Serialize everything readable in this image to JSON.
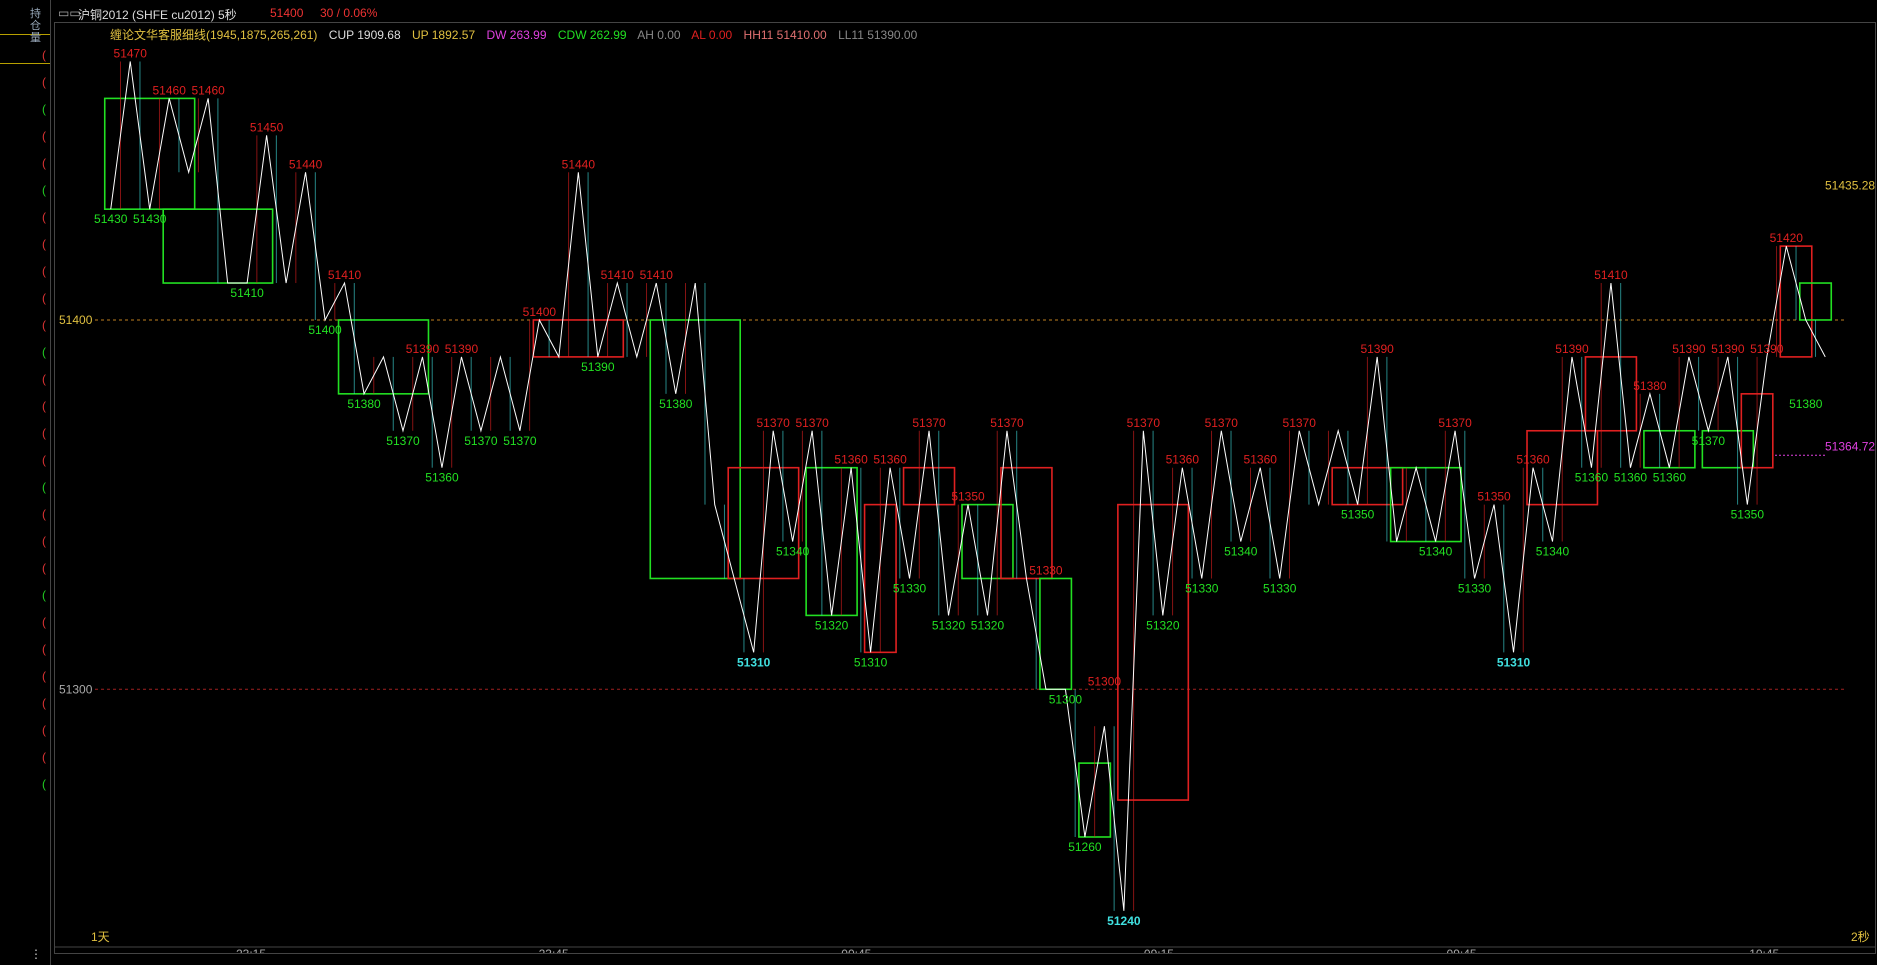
{
  "header": {
    "symbol": "沪铜2012 (SHFE cu2012)",
    "period": "5秒",
    "last_price": "51400",
    "change": "30 / 0.06%"
  },
  "indicator": {
    "name": "缠论文华客服细线(1945,1875,265,261)",
    "cup": "CUP 1909.68",
    "up": "UP 1892.57",
    "dw": "DW 263.99",
    "cdw": "CDW 262.99",
    "ah": "AH 0.00",
    "al": "AL 0.00",
    "hh": "HH11 51410.00",
    "ll": "LL11 51390.00"
  },
  "left_strip": {
    "vertical_text": "持仓量",
    "bottom": "⋮"
  },
  "colors": {
    "red": "#e02020",
    "green": "#22e022",
    "white": "#ffffff",
    "cyan": "#40e0e0",
    "gold": "#e0c040",
    "magenta": "#e040e0",
    "gray": "#aaaaaa"
  },
  "chart_data": {
    "type": "line",
    "y_range": [
      51234,
      51475
    ],
    "y_ticks": [
      {
        "value": 51400,
        "label": "51400"
      },
      {
        "value": 51300,
        "label": "51300"
      }
    ],
    "x_ticks": [
      "23:15",
      "23:45",
      "00:45",
      "09:15",
      "09:45",
      "10:45"
    ],
    "corner_labels": {
      "left": "1天",
      "right": "2秒"
    },
    "right_labels": [
      {
        "value": 51435.28,
        "label": "51435.28",
        "color": "gold"
      },
      {
        "value": 51364.72,
        "label": "51364.72",
        "color": "magenta"
      }
    ],
    "zigzag": [
      [
        0,
        51430
      ],
      [
        1,
        51470
      ],
      [
        2,
        51430
      ],
      [
        3,
        51460
      ],
      [
        4,
        51440
      ],
      [
        5,
        51460
      ],
      [
        6,
        51410
      ],
      [
        7,
        51410
      ],
      [
        8,
        51450
      ],
      [
        9,
        51410
      ],
      [
        10,
        51440
      ],
      [
        11,
        51400
      ],
      [
        12,
        51410
      ],
      [
        13,
        51380
      ],
      [
        14,
        51390
      ],
      [
        15,
        51370
      ],
      [
        16,
        51390
      ],
      [
        17,
        51360
      ],
      [
        18,
        51390
      ],
      [
        19,
        51370
      ],
      [
        20,
        51390
      ],
      [
        21,
        51370
      ],
      [
        22,
        51400
      ],
      [
        23,
        51390
      ],
      [
        24,
        51440
      ],
      [
        25,
        51390
      ],
      [
        26,
        51410
      ],
      [
        27,
        51390
      ],
      [
        28,
        51410
      ],
      [
        29,
        51380
      ],
      [
        30,
        51410
      ],
      [
        31,
        51350
      ],
      [
        32,
        51330
      ],
      [
        33,
        51310
      ],
      [
        34,
        51370
      ],
      [
        35,
        51340
      ],
      [
        36,
        51370
      ],
      [
        37,
        51320
      ],
      [
        38,
        51360
      ],
      [
        39,
        51310
      ],
      [
        40,
        51360
      ],
      [
        41,
        51330
      ],
      [
        42,
        51370
      ],
      [
        43,
        51320
      ],
      [
        44,
        51350
      ],
      [
        45,
        51320
      ],
      [
        46,
        51370
      ],
      [
        47,
        51330
      ],
      [
        48,
        51300
      ],
      [
        49,
        51300
      ],
      [
        50,
        51260
      ],
      [
        51,
        51290
      ],
      [
        52,
        51240
      ],
      [
        53,
        51370
      ],
      [
        54,
        51320
      ],
      [
        55,
        51360
      ],
      [
        56,
        51330
      ],
      [
        57,
        51370
      ],
      [
        58,
        51340
      ],
      [
        59,
        51360
      ],
      [
        60,
        51330
      ],
      [
        61,
        51370
      ],
      [
        62,
        51350
      ],
      [
        63,
        51370
      ],
      [
        64,
        51350
      ],
      [
        65,
        51390
      ],
      [
        66,
        51340
      ],
      [
        67,
        51360
      ],
      [
        68,
        51340
      ],
      [
        69,
        51370
      ],
      [
        70,
        51330
      ],
      [
        71,
        51350
      ],
      [
        72,
        51310
      ],
      [
        73,
        51360
      ],
      [
        74,
        51340
      ],
      [
        75,
        51390
      ],
      [
        76,
        51360
      ],
      [
        77,
        51410
      ],
      [
        78,
        51360
      ],
      [
        79,
        51380
      ],
      [
        80,
        51360
      ],
      [
        81,
        51390
      ],
      [
        82,
        51370
      ],
      [
        83,
        51390
      ],
      [
        84,
        51350
      ],
      [
        85,
        51390
      ],
      [
        86,
        51420
      ],
      [
        87,
        51400
      ],
      [
        88,
        51390
      ]
    ],
    "price_labels": [
      {
        "i": 1,
        "v": 51470,
        "t": "51470",
        "c": "red",
        "pos": "above"
      },
      {
        "i": 3,
        "v": 51460,
        "t": "51460",
        "c": "red",
        "pos": "above"
      },
      {
        "i": 5,
        "v": 51460,
        "t": "51460",
        "c": "red",
        "pos": "above"
      },
      {
        "i": 8,
        "v": 51450,
        "t": "51450",
        "c": "red",
        "pos": "above"
      },
      {
        "i": 10,
        "v": 51440,
        "t": "51440",
        "c": "red",
        "pos": "above"
      },
      {
        "i": 12,
        "v": 51410,
        "t": "51410",
        "c": "red",
        "pos": "above"
      },
      {
        "i": 16,
        "v": 51390,
        "t": "51390",
        "c": "red",
        "pos": "above"
      },
      {
        "i": 18,
        "v": 51390,
        "t": "51390",
        "c": "red",
        "pos": "above"
      },
      {
        "i": 22,
        "v": 51400,
        "t": "51400",
        "c": "red",
        "pos": "above"
      },
      {
        "i": 24,
        "v": 51440,
        "t": "51440",
        "c": "red",
        "pos": "above"
      },
      {
        "i": 26,
        "v": 51410,
        "t": "51410",
        "c": "red",
        "pos": "above"
      },
      {
        "i": 28,
        "v": 51410,
        "t": "51410",
        "c": "red",
        "pos": "above"
      },
      {
        "i": 34,
        "v": 51370,
        "t": "51370",
        "c": "red",
        "pos": "above"
      },
      {
        "i": 36,
        "v": 51370,
        "t": "51370",
        "c": "red",
        "pos": "above"
      },
      {
        "i": 38,
        "v": 51360,
        "t": "51360",
        "c": "red",
        "pos": "above"
      },
      {
        "i": 40,
        "v": 51360,
        "t": "51360",
        "c": "red",
        "pos": "above"
      },
      {
        "i": 42,
        "v": 51370,
        "t": "51370",
        "c": "red",
        "pos": "above"
      },
      {
        "i": 44,
        "v": 51350,
        "t": "51350",
        "c": "red",
        "pos": "above"
      },
      {
        "i": 46,
        "v": 51370,
        "t": "51370",
        "c": "red",
        "pos": "above"
      },
      {
        "i": 48,
        "v": 51330,
        "t": "51330",
        "c": "red",
        "pos": "above"
      },
      {
        "i": 51,
        "v": 51300,
        "t": "51300",
        "c": "red",
        "pos": "above"
      },
      {
        "i": 53,
        "v": 51370,
        "t": "51370",
        "c": "red",
        "pos": "above"
      },
      {
        "i": 55,
        "v": 51360,
        "t": "51360",
        "c": "red",
        "pos": "above"
      },
      {
        "i": 57,
        "v": 51370,
        "t": "51370",
        "c": "red",
        "pos": "above"
      },
      {
        "i": 59,
        "v": 51360,
        "t": "51360",
        "c": "red",
        "pos": "above"
      },
      {
        "i": 61,
        "v": 51370,
        "t": "51370",
        "c": "red",
        "pos": "above"
      },
      {
        "i": 65,
        "v": 51390,
        "t": "51390",
        "c": "red",
        "pos": "above"
      },
      {
        "i": 69,
        "v": 51370,
        "t": "51370",
        "c": "red",
        "pos": "above"
      },
      {
        "i": 71,
        "v": 51350,
        "t": "51350",
        "c": "red",
        "pos": "above"
      },
      {
        "i": 73,
        "v": 51360,
        "t": "51360",
        "c": "red",
        "pos": "above"
      },
      {
        "i": 75,
        "v": 51390,
        "t": "51390",
        "c": "red",
        "pos": "above"
      },
      {
        "i": 77,
        "v": 51410,
        "t": "51410",
        "c": "red",
        "pos": "above"
      },
      {
        "i": 79,
        "v": 51380,
        "t": "51380",
        "c": "red",
        "pos": "above"
      },
      {
        "i": 81,
        "v": 51390,
        "t": "51390",
        "c": "red",
        "pos": "above"
      },
      {
        "i": 83,
        "v": 51390,
        "t": "51390",
        "c": "red",
        "pos": "above"
      },
      {
        "i": 85,
        "v": 51390,
        "t": "51390",
        "c": "red",
        "pos": "above"
      },
      {
        "i": 86,
        "v": 51420,
        "t": "51420",
        "c": "red",
        "pos": "above"
      },
      {
        "i": 0,
        "v": 51430,
        "t": "51430",
        "c": "green",
        "pos": "below"
      },
      {
        "i": 2,
        "v": 51430,
        "t": "51430",
        "c": "green",
        "pos": "below"
      },
      {
        "i": 7,
        "v": 51410,
        "t": "51410",
        "c": "green",
        "pos": "below"
      },
      {
        "i": 11,
        "v": 51400,
        "t": "51400",
        "c": "green",
        "pos": "below"
      },
      {
        "i": 13,
        "v": 51380,
        "t": "51380",
        "c": "green",
        "pos": "below"
      },
      {
        "i": 15,
        "v": 51370,
        "t": "51370",
        "c": "green",
        "pos": "below"
      },
      {
        "i": 17,
        "v": 51360,
        "t": "51360",
        "c": "green",
        "pos": "below"
      },
      {
        "i": 19,
        "v": 51370,
        "t": "51370",
        "c": "green",
        "pos": "below"
      },
      {
        "i": 21,
        "v": 51370,
        "t": "51370",
        "c": "green",
        "pos": "below"
      },
      {
        "i": 25,
        "v": 51390,
        "t": "51390",
        "c": "green",
        "pos": "below"
      },
      {
        "i": 29,
        "v": 51380,
        "t": "51380",
        "c": "green",
        "pos": "below"
      },
      {
        "i": 33,
        "v": 51310,
        "t": "51310",
        "c": "cyan",
        "pos": "below"
      },
      {
        "i": 35,
        "v": 51340,
        "t": "51340",
        "c": "green",
        "pos": "below"
      },
      {
        "i": 37,
        "v": 51320,
        "t": "51320",
        "c": "green",
        "pos": "below"
      },
      {
        "i": 39,
        "v": 51310,
        "t": "51310",
        "c": "green",
        "pos": "below"
      },
      {
        "i": 41,
        "v": 51330,
        "t": "51330",
        "c": "green",
        "pos": "below"
      },
      {
        "i": 43,
        "v": 51320,
        "t": "51320",
        "c": "green",
        "pos": "below"
      },
      {
        "i": 45,
        "v": 51320,
        "t": "51320",
        "c": "green",
        "pos": "below"
      },
      {
        "i": 49,
        "v": 51300,
        "t": "51300",
        "c": "green",
        "pos": "below"
      },
      {
        "i": 50,
        "v": 51260,
        "t": "51260",
        "c": "green",
        "pos": "below"
      },
      {
        "i": 52,
        "v": 51240,
        "t": "51240",
        "c": "cyan",
        "pos": "below"
      },
      {
        "i": 54,
        "v": 51320,
        "t": "51320",
        "c": "green",
        "pos": "below"
      },
      {
        "i": 56,
        "v": 51330,
        "t": "51330",
        "c": "green",
        "pos": "below"
      },
      {
        "i": 58,
        "v": 51340,
        "t": "51340",
        "c": "green",
        "pos": "below"
      },
      {
        "i": 60,
        "v": 51330,
        "t": "51330",
        "c": "green",
        "pos": "below"
      },
      {
        "i": 64,
        "v": 51350,
        "t": "51350",
        "c": "green",
        "pos": "below"
      },
      {
        "i": 68,
        "v": 51340,
        "t": "51340",
        "c": "green",
        "pos": "below"
      },
      {
        "i": 70,
        "v": 51330,
        "t": "51330",
        "c": "green",
        "pos": "below"
      },
      {
        "i": 72,
        "v": 51310,
        "t": "51310",
        "c": "cyan",
        "pos": "below"
      },
      {
        "i": 74,
        "v": 51340,
        "t": "51340",
        "c": "green",
        "pos": "below"
      },
      {
        "i": 76,
        "v": 51360,
        "t": "51360",
        "c": "green",
        "pos": "below"
      },
      {
        "i": 78,
        "v": 51360,
        "t": "51360",
        "c": "green",
        "pos": "below"
      },
      {
        "i": 80,
        "v": 51360,
        "t": "51360",
        "c": "green",
        "pos": "below"
      },
      {
        "i": 82,
        "v": 51370,
        "t": "51370",
        "c": "green",
        "pos": "below"
      },
      {
        "i": 84,
        "v": 51350,
        "t": "51350",
        "c": "green",
        "pos": "below"
      },
      {
        "i": 87,
        "v": 51380,
        "t": "51380",
        "c": "green",
        "pos": "below"
      }
    ],
    "boxes": [
      {
        "i0": 0,
        "i1": 4,
        "top": 51460,
        "bottom": 51430,
        "c": "green"
      },
      {
        "i0": 3,
        "i1": 8,
        "top": 51430,
        "bottom": 51410,
        "c": "green"
      },
      {
        "i0": 12,
        "i1": 16,
        "top": 51400,
        "bottom": 51380,
        "c": "green"
      },
      {
        "i0": 22,
        "i1": 26,
        "top": 51400,
        "bottom": 51390,
        "c": "red"
      },
      {
        "i0": 28,
        "i1": 32,
        "top": 51400,
        "bottom": 51330,
        "c": "green"
      },
      {
        "i0": 32,
        "i1": 35,
        "top": 51360,
        "bottom": 51330,
        "c": "red"
      },
      {
        "i0": 36,
        "i1": 38,
        "top": 51360,
        "bottom": 51320,
        "c": "green"
      },
      {
        "i0": 39,
        "i1": 40,
        "top": 51350,
        "bottom": 51310,
        "c": "red"
      },
      {
        "i0": 41,
        "i1": 43,
        "top": 51360,
        "bottom": 51350,
        "c": "red"
      },
      {
        "i0": 44,
        "i1": 46,
        "top": 51350,
        "bottom": 51330,
        "c": "green"
      },
      {
        "i0": 46,
        "i1": 48,
        "top": 51360,
        "bottom": 51330,
        "c": "red"
      },
      {
        "i0": 48,
        "i1": 49,
        "top": 51330,
        "bottom": 51300,
        "c": "green"
      },
      {
        "i0": 50,
        "i1": 51,
        "top": 51280,
        "bottom": 51260,
        "c": "green"
      },
      {
        "i0": 52,
        "i1": 55,
        "top": 51350,
        "bottom": 51270,
        "c": "red"
      },
      {
        "i0": 63,
        "i1": 66,
        "top": 51360,
        "bottom": 51350,
        "c": "red"
      },
      {
        "i0": 66,
        "i1": 69,
        "top": 51360,
        "bottom": 51340,
        "c": "green"
      },
      {
        "i0": 73,
        "i1": 76,
        "top": 51370,
        "bottom": 51350,
        "c": "red"
      },
      {
        "i0": 76,
        "i1": 78,
        "top": 51390,
        "bottom": 51370,
        "c": "red"
      },
      {
        "i0": 79,
        "i1": 81,
        "top": 51370,
        "bottom": 51360,
        "c": "green"
      },
      {
        "i0": 82,
        "i1": 84,
        "top": 51370,
        "bottom": 51360,
        "c": "green"
      },
      {
        "i0": 84,
        "i1": 85,
        "top": 51380,
        "bottom": 51360,
        "c": "red"
      },
      {
        "i0": 86,
        "i1": 87,
        "top": 51420,
        "bottom": 51390,
        "c": "red"
      },
      {
        "i0": 87,
        "i1": 88,
        "top": 51410,
        "bottom": 51400,
        "c": "green"
      }
    ]
  }
}
